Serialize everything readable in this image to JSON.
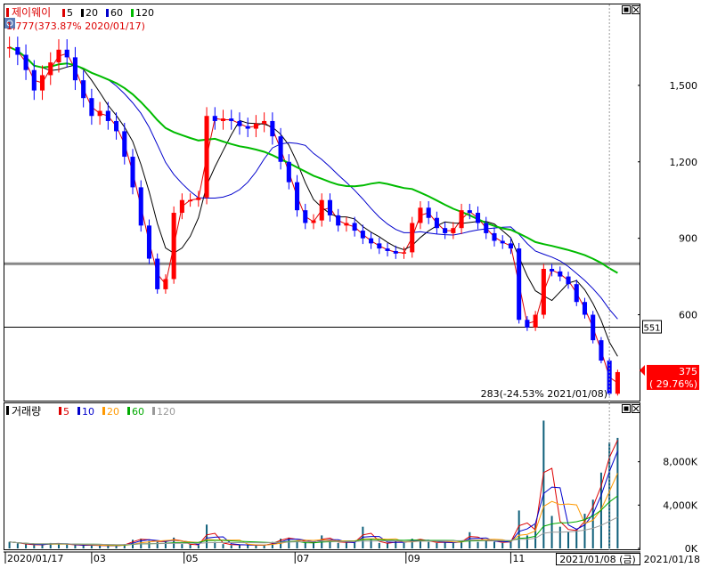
{
  "price_panel": {
    "stock_name": "제이웨이",
    "ma_legend": [
      {
        "label": "5",
        "color": "#dd0000"
      },
      {
        "label": "20",
        "color": "#000000"
      },
      {
        "label": "60",
        "color": "#0000cc"
      },
      {
        "label": "120",
        "color": "#00bb00"
      }
    ],
    "high_note": "1,777(373.87% 2020/01/17)",
    "low_note": "283(-24.53% 2021/01/08)",
    "y_ticks": [
      {
        "value": 600,
        "label": "600"
      },
      {
        "value": 900,
        "label": "900"
      },
      {
        "value": 1200,
        "label": "1,200"
      },
      {
        "value": 1500,
        "label": "1,500"
      }
    ],
    "ylim": [
      270,
      1800
    ],
    "horizontal_lines": [
      {
        "value": 551,
        "label": "551",
        "color": "#000000"
      },
      {
        "value": 800,
        "label": "",
        "color": "#888888"
      }
    ],
    "current": {
      "value": 375,
      "label": "375",
      "change_label": "( 29.76%)",
      "color": "#ff0000"
    }
  },
  "volume_panel": {
    "title": "거래량",
    "ma_legend": [
      {
        "label": "5",
        "color": "#dd0000"
      },
      {
        "label": "10",
        "color": "#0000cc"
      },
      {
        "label": "20",
        "color": "#ff9900"
      },
      {
        "label": "60",
        "color": "#00aa00"
      },
      {
        "label": "120",
        "color": "#999999"
      }
    ],
    "y_ticks": [
      {
        "value": 0,
        "label": "0K"
      },
      {
        "value": 4000,
        "label": "4,000K"
      },
      {
        "value": 8000,
        "label": "8,000K"
      }
    ],
    "ylim": [
      0,
      12000
    ]
  },
  "x_axis": {
    "labels": [
      {
        "t": 0,
        "label": "2020/01/17"
      },
      {
        "t": 0.14,
        "label": "03"
      },
      {
        "t": 0.29,
        "label": "05"
      },
      {
        "t": 0.47,
        "label": "07"
      },
      {
        "t": 0.65,
        "label": "09"
      },
      {
        "t": 0.82,
        "label": "11"
      }
    ],
    "cursor_label": "2021/01/08 (금)",
    "end_label": "2021/01/18"
  },
  "chart_data": {
    "type": "candlestick",
    "x_start": "2020/01/17",
    "x_end": "2021/01/18",
    "series": [
      {
        "name": "price",
        "values": [
          1650,
          1620,
          1560,
          1480,
          1540,
          1590,
          1640,
          1610,
          1520,
          1450,
          1380,
          1400,
          1360,
          1320,
          1220,
          1100,
          950,
          820,
          700,
          740,
          1000,
          1050,
          1050,
          1060,
          1380,
          1360,
          1370,
          1360,
          1340,
          1330,
          1350,
          1360,
          1300,
          1200,
          1120,
          1010,
          960,
          970,
          1050,
          990,
          950,
          960,
          930,
          900,
          880,
          860,
          850,
          840,
          845,
          960,
          1020,
          980,
          940,
          920,
          940,
          1010,
          1000,
          960,
          920,
          890,
          880,
          860,
          580,
          550,
          600,
          780,
          770,
          750,
          720,
          650,
          600,
          500,
          420,
          290,
          375
        ]
      },
      {
        "name": "volume",
        "values": [
          600,
          450,
          380,
          300,
          350,
          500,
          420,
          350,
          300,
          280,
          300,
          260,
          250,
          240,
          400,
          800,
          900,
          700,
          600,
          650,
          1000,
          400,
          350,
          300,
          2200,
          600,
          400,
          300,
          350,
          300,
          300,
          280,
          600,
          900,
          1000,
          700,
          600,
          500,
          1200,
          700,
          500,
          600,
          500,
          2000,
          800,
          500,
          450,
          700,
          500,
          900,
          800,
          600,
          500,
          600,
          500,
          700,
          1500,
          600,
          800,
          600,
          500,
          700,
          3500,
          1200,
          2200,
          11800,
          3000,
          2000,
          1500,
          1800,
          3200,
          4500,
          7000,
          9800,
          10200
        ]
      }
    ],
    "moving_averages": [
      "5",
      "20",
      "60",
      "120"
    ]
  }
}
